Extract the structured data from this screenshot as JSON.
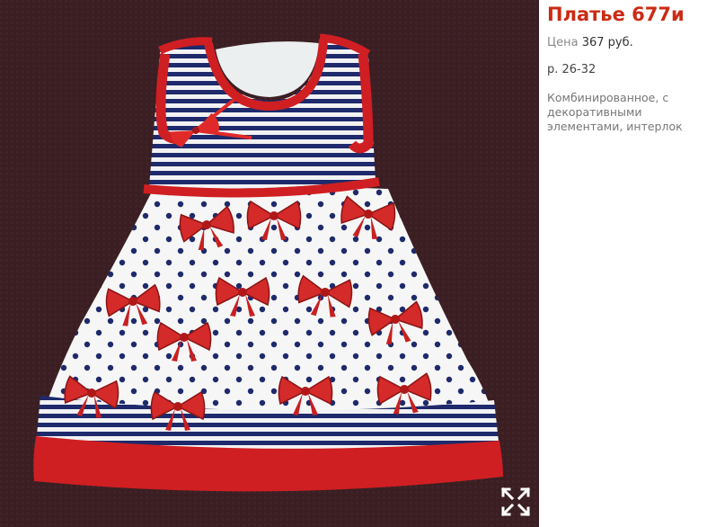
{
  "product": {
    "title": "Платье 677и",
    "price_label": "Цена",
    "price_value": "367 руб.",
    "size": "р. 26-32",
    "description": "Комбинированное, с декоративными элементами, интерлок"
  },
  "photo": {
    "expand_icon": "expand-arrows-icon"
  },
  "colors": {
    "background": "#3b1f22",
    "dress_red": "#cf1f22",
    "stripe_navy": "#1e2a6b",
    "title_red": "#cc2a14"
  }
}
